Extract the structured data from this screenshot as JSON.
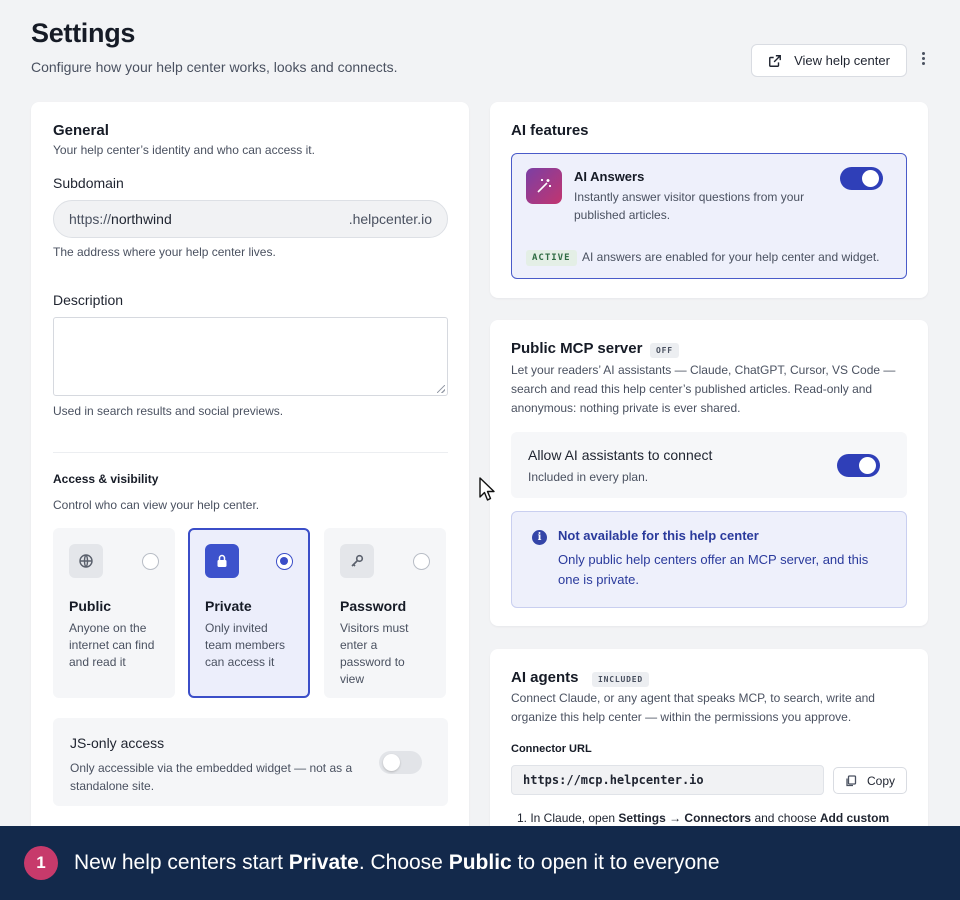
{
  "header": {
    "title": "Settings",
    "subtitle": "Configure how your help center works, looks and connects.",
    "view_button": "View help center"
  },
  "general": {
    "title": "General",
    "subtitle": "Your help center’s identity and who can access it.",
    "subdomain_label": "Subdomain",
    "subdomain_prefix": "https://",
    "subdomain_value": "northwind",
    "subdomain_suffix": ".helpcenter.io",
    "subdomain_help": "The address where your help center lives.",
    "description_label": "Description",
    "description_value": "",
    "description_help": "Used in search results and social previews."
  },
  "access": {
    "title": "Access & visibility",
    "subtitle": "Control who can view your help center.",
    "selected": "private",
    "options": [
      {
        "id": "public",
        "title": "Public",
        "desc": "Anyone on the internet can find and read it"
      },
      {
        "id": "private",
        "title": "Private",
        "desc": "Only invited team members can access it"
      },
      {
        "id": "password",
        "title": "Password",
        "desc": "Visitors must enter a password to view"
      }
    ],
    "js_only_title": "JS-only access",
    "js_only_desc": "Only accessible via the embedded widget — not as a standalone site.",
    "js_only_enabled": false
  },
  "ai_features": {
    "title": "AI features",
    "answers_title": "AI Answers",
    "answers_desc": "Instantly answer visitor questions from your published articles.",
    "answers_enabled": true,
    "status_badge": "ACTIVE",
    "status_text": "AI answers are enabled for your help center and widget."
  },
  "mcp": {
    "title": "Public MCP server",
    "badge": "OFF",
    "desc": "Let your readers’ AI assistants — Claude, ChatGPT, Cursor, VS Code — search and read this help center’s published articles. Read-only and anonymous: nothing private is ever shared.",
    "allow_title": "Allow AI assistants to connect",
    "allow_desc": "Included in every plan.",
    "allow_enabled": true,
    "notice_title": "Not available for this help center",
    "notice_text": "Only public help centers offer an MCP server, and this one is private."
  },
  "agents": {
    "title": "AI agents",
    "badge": "INCLUDED",
    "desc": "Connect Claude, or any agent that speaks MCP, to search, write and organize this help center — within the permissions you approve.",
    "connector_label": "Connector URL",
    "connector_url": "https://mcp.helpcenter.io",
    "copy_label": "Copy",
    "step1_prefix": "1. In Claude, open ",
    "step1_bold1": "Settings → Connectors",
    "step1_mid": " and choose ",
    "step1_bold2": "Add custom"
  },
  "banner": {
    "step": "1",
    "text_1": "New help centers start ",
    "bold_1": "Private",
    "text_2": ". Choose ",
    "bold_2": "Public",
    "text_3": " to open it to everyone"
  },
  "colors": {
    "accent": "#3b4ec8",
    "toggle_on": "#2f3fb8",
    "banner_bg": "#13294b",
    "step_badge": "#c73a6b"
  }
}
